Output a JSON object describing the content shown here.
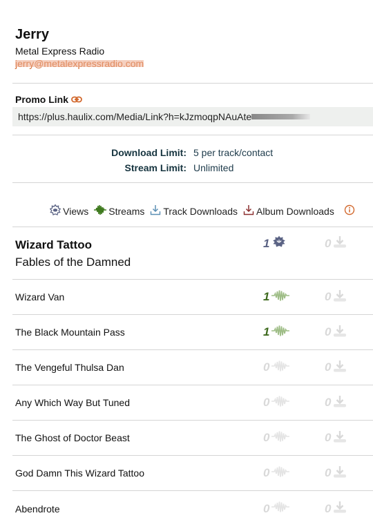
{
  "contact": {
    "name": "Jerry",
    "organization": "Metal Express Radio",
    "email": "jerry@metalexpressradio.com"
  },
  "promo": {
    "title": "Promo Link",
    "link_icon": "link-icon",
    "url": "https://plus.haulix.com/Media/Link?h=kJzmoqpNAuAte"
  },
  "limits": {
    "download_label": "Download Limit:",
    "download_value": "5 per track/contact",
    "stream_label": "Stream Limit:",
    "stream_value": "Unlimited"
  },
  "legend": {
    "items": [
      {
        "icon": "views-icon",
        "label": "Views"
      },
      {
        "icon": "streams-icon",
        "label": "Streams"
      },
      {
        "icon": "track-download-icon",
        "label": "Track Downloads"
      },
      {
        "icon": "album-download-icon",
        "label": "Album Downloads"
      }
    ],
    "info_icon": "info-icon"
  },
  "colors": {
    "views": "#5b6384",
    "streams": "#3f6b1f",
    "streams_icon": "#9ebd86",
    "track_download": "#5b8fb4",
    "album_download": "#8b2e2e",
    "accent": "#d2692e",
    "zero": "#d9d9d9"
  },
  "album": {
    "artist": "Wizard Tattoo",
    "title": "Fables of the Damned",
    "views": "1",
    "album_downloads": "0"
  },
  "tracks": [
    {
      "title": "Wizard Van",
      "streams": "1",
      "downloads": "0"
    },
    {
      "title": "The Black Mountain Pass",
      "streams": "1",
      "downloads": "0"
    },
    {
      "title": "The Vengeful Thulsa Dan",
      "streams": "0",
      "downloads": "0"
    },
    {
      "title": "Any Which Way But Tuned",
      "streams": "0",
      "downloads": "0"
    },
    {
      "title": "The Ghost of Doctor Beast",
      "streams": "0",
      "downloads": "0"
    },
    {
      "title": "God Damn This Wizard Tattoo",
      "streams": "0",
      "downloads": "0"
    },
    {
      "title": "Abendrote",
      "streams": "0",
      "downloads": "0"
    }
  ]
}
